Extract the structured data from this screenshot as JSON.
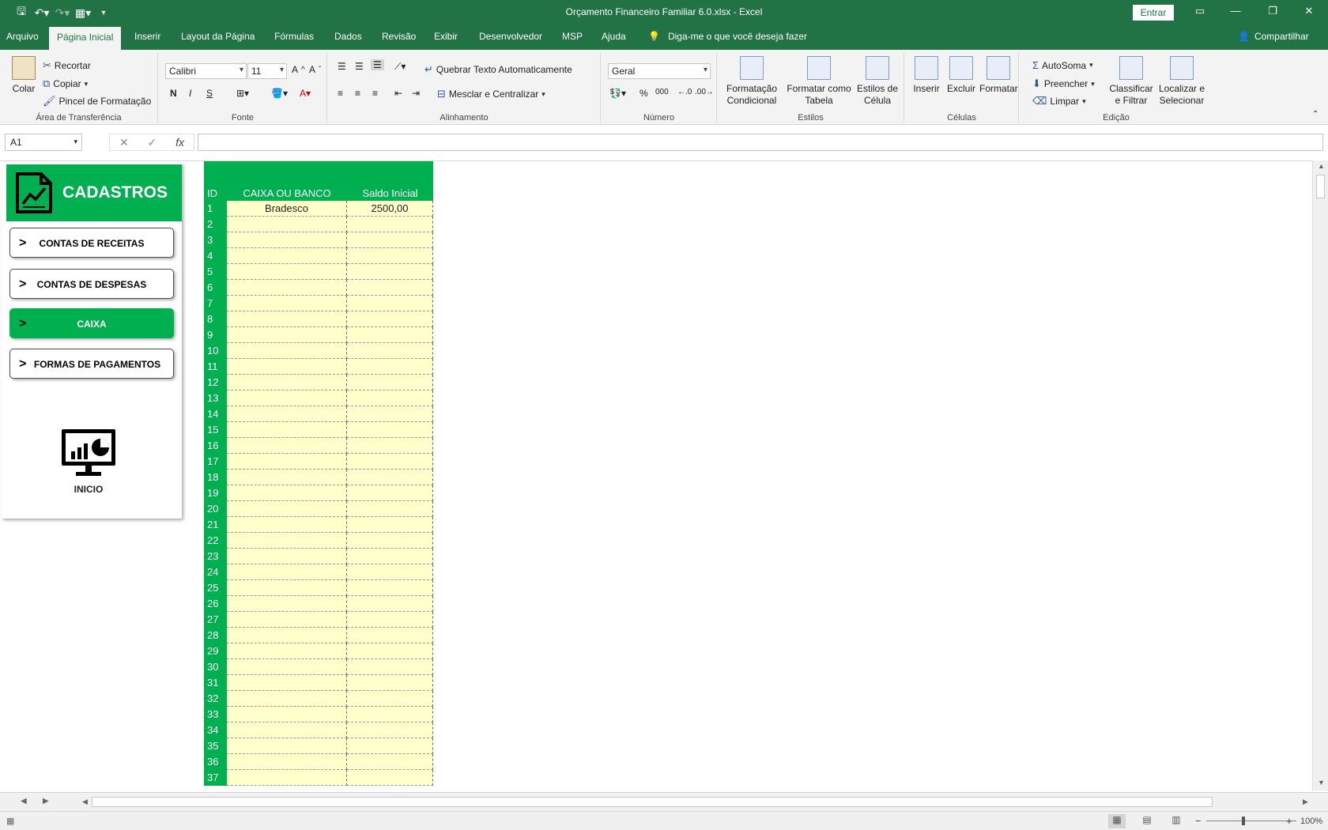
{
  "window": {
    "title": "Orçamento Financeiro Familiar 6.0.xlsx  -  Excel",
    "sign_in": "Entrar",
    "qat": [
      "save-icon",
      "undo-icon",
      "redo-icon",
      "form-icon",
      "customize-icon"
    ]
  },
  "menu": {
    "tabs": [
      "Arquivo",
      "Página Inicial",
      "Inserir",
      "Layout da Página",
      "Fórmulas",
      "Dados",
      "Revisão",
      "Exibir",
      "Desenvolvedor",
      "MSP",
      "Ajuda"
    ],
    "active_tab": "Página Inicial",
    "tell_me": "Diga-me o que você deseja fazer",
    "share": "Compartilhar"
  },
  "ribbon": {
    "clipboard": {
      "paste": "Colar",
      "cut": "Recortar",
      "copy": "Copiar",
      "format_painter": "Pincel de Formatação",
      "label": "Área de Transferência"
    },
    "font": {
      "name": "Calibri",
      "size": "11",
      "bold": "N",
      "italic": "I",
      "underline": "S",
      "label": "Fonte"
    },
    "alignment": {
      "wrap": "Quebrar Texto Automaticamente",
      "merge": "Mesclar e Centralizar",
      "label": "Alinhamento"
    },
    "number": {
      "format": "Geral",
      "percent": "%",
      "thousands": "000",
      "label": "Número"
    },
    "styles": {
      "conditional": [
        "Formatação",
        "Condicional"
      ],
      "as_table": [
        "Formatar como",
        "Tabela"
      ],
      "cell_styles": [
        "Estilos de",
        "Célula"
      ],
      "label": "Estilos"
    },
    "cells": {
      "insert": "Inserir",
      "delete": "Excluir",
      "format": "Formatar",
      "label": "Células"
    },
    "editing": {
      "autosum": "AutoSoma",
      "fill": "Preencher",
      "clear": "Limpar",
      "sort": [
        "Classificar",
        "e Filtrar"
      ],
      "find": [
        "Localizar e",
        "Selecionar"
      ],
      "label": "Edição"
    }
  },
  "formula_bar": {
    "name_box": "A1",
    "fx": "fx",
    "value": ""
  },
  "panel": {
    "title": "CADASTROS",
    "buttons": [
      {
        "label": "CONTAS DE RECEITAS",
        "selected": false
      },
      {
        "label": "CONTAS DE DESPESAS",
        "selected": false
      },
      {
        "label": "CAIXA",
        "selected": true
      },
      {
        "label": "FORMAS DE PAGAMENTOS",
        "selected": false
      }
    ],
    "arrow": ">",
    "home_label": "INICIO"
  },
  "table": {
    "headers": {
      "id": "ID",
      "name": "CAIXA OU BANCO",
      "balance": "Saldo Inicial"
    },
    "rows": [
      {
        "id": "1",
        "name": "Bradesco",
        "balance": "2500,00"
      },
      {
        "id": "2",
        "name": "",
        "balance": ""
      },
      {
        "id": "3",
        "name": "",
        "balance": ""
      },
      {
        "id": "4",
        "name": "",
        "balance": ""
      },
      {
        "id": "5",
        "name": "",
        "balance": ""
      },
      {
        "id": "6",
        "name": "",
        "balance": ""
      },
      {
        "id": "7",
        "name": "",
        "balance": ""
      },
      {
        "id": "8",
        "name": "",
        "balance": ""
      },
      {
        "id": "9",
        "name": "",
        "balance": ""
      },
      {
        "id": "10",
        "name": "",
        "balance": ""
      },
      {
        "id": "11",
        "name": "",
        "balance": ""
      },
      {
        "id": "12",
        "name": "",
        "balance": ""
      },
      {
        "id": "13",
        "name": "",
        "balance": ""
      },
      {
        "id": "14",
        "name": "",
        "balance": ""
      },
      {
        "id": "15",
        "name": "",
        "balance": ""
      },
      {
        "id": "16",
        "name": "",
        "balance": ""
      },
      {
        "id": "17",
        "name": "",
        "balance": ""
      },
      {
        "id": "18",
        "name": "",
        "balance": ""
      },
      {
        "id": "19",
        "name": "",
        "balance": ""
      },
      {
        "id": "20",
        "name": "",
        "balance": ""
      },
      {
        "id": "21",
        "name": "",
        "balance": ""
      },
      {
        "id": "22",
        "name": "",
        "balance": ""
      },
      {
        "id": "23",
        "name": "",
        "balance": ""
      },
      {
        "id": "24",
        "name": "",
        "balance": ""
      },
      {
        "id": "25",
        "name": "",
        "balance": ""
      },
      {
        "id": "26",
        "name": "",
        "balance": ""
      },
      {
        "id": "27",
        "name": "",
        "balance": ""
      },
      {
        "id": "28",
        "name": "",
        "balance": ""
      },
      {
        "id": "29",
        "name": "",
        "balance": ""
      },
      {
        "id": "30",
        "name": "",
        "balance": ""
      },
      {
        "id": "31",
        "name": "",
        "balance": ""
      },
      {
        "id": "32",
        "name": "",
        "balance": ""
      },
      {
        "id": "33",
        "name": "",
        "balance": ""
      },
      {
        "id": "34",
        "name": "",
        "balance": ""
      },
      {
        "id": "35",
        "name": "",
        "balance": ""
      },
      {
        "id": "36",
        "name": "",
        "balance": ""
      },
      {
        "id": "37",
        "name": "",
        "balance": ""
      }
    ]
  },
  "status": {
    "zoom": "100%",
    "zoom_minus": "−",
    "zoom_plus": "+"
  },
  "colors": {
    "excel_green": "#217346",
    "accent_green": "#00b050",
    "input_yellow": "#ffffcc"
  }
}
